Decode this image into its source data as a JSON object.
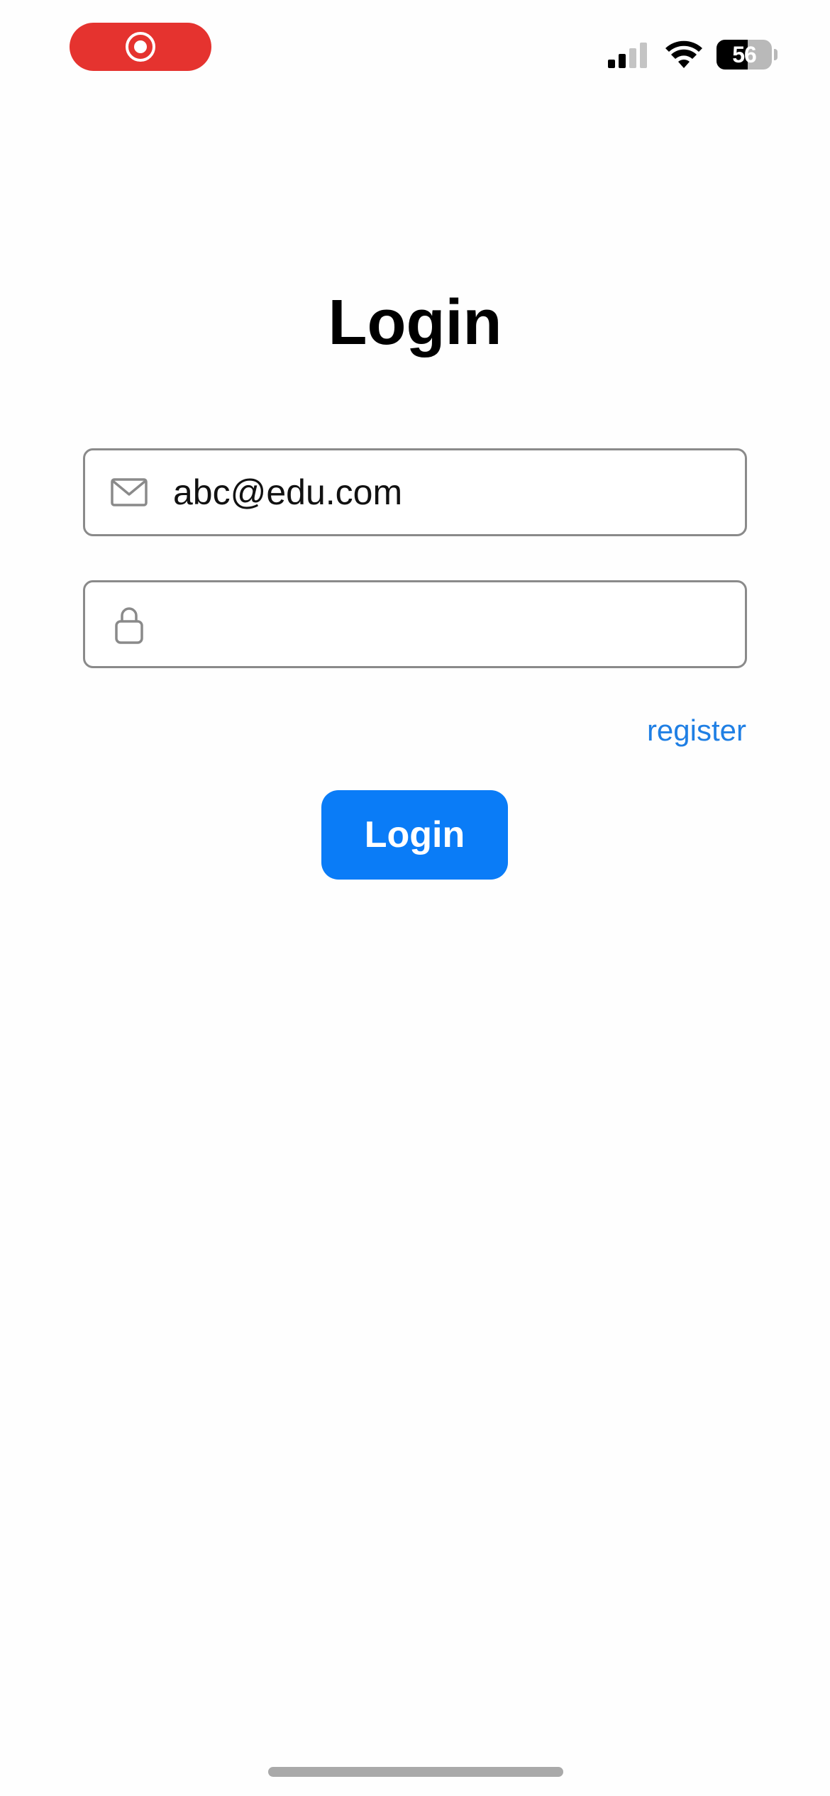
{
  "status_bar": {
    "recording_indicator_color": "#e5332f",
    "battery_level": "56",
    "battery_fraction": 0.56,
    "signal_bars_active": 2,
    "signal_bars_total": 4
  },
  "icons": {
    "recording": "screen-record-icon",
    "signal": "cellular-signal-icon",
    "wifi": "wifi-icon",
    "battery": "battery-icon",
    "email": "envelope-icon",
    "password": "lock-icon"
  },
  "login_form": {
    "title": "Login",
    "email": {
      "value": "abc@edu.com",
      "placeholder": ""
    },
    "password": {
      "value": "",
      "placeholder": ""
    },
    "register_label": "register",
    "submit_label": "Login"
  },
  "colors": {
    "accent": "#0a7cf7",
    "link": "#1f7fe4",
    "field_border": "#8a8a8a"
  }
}
